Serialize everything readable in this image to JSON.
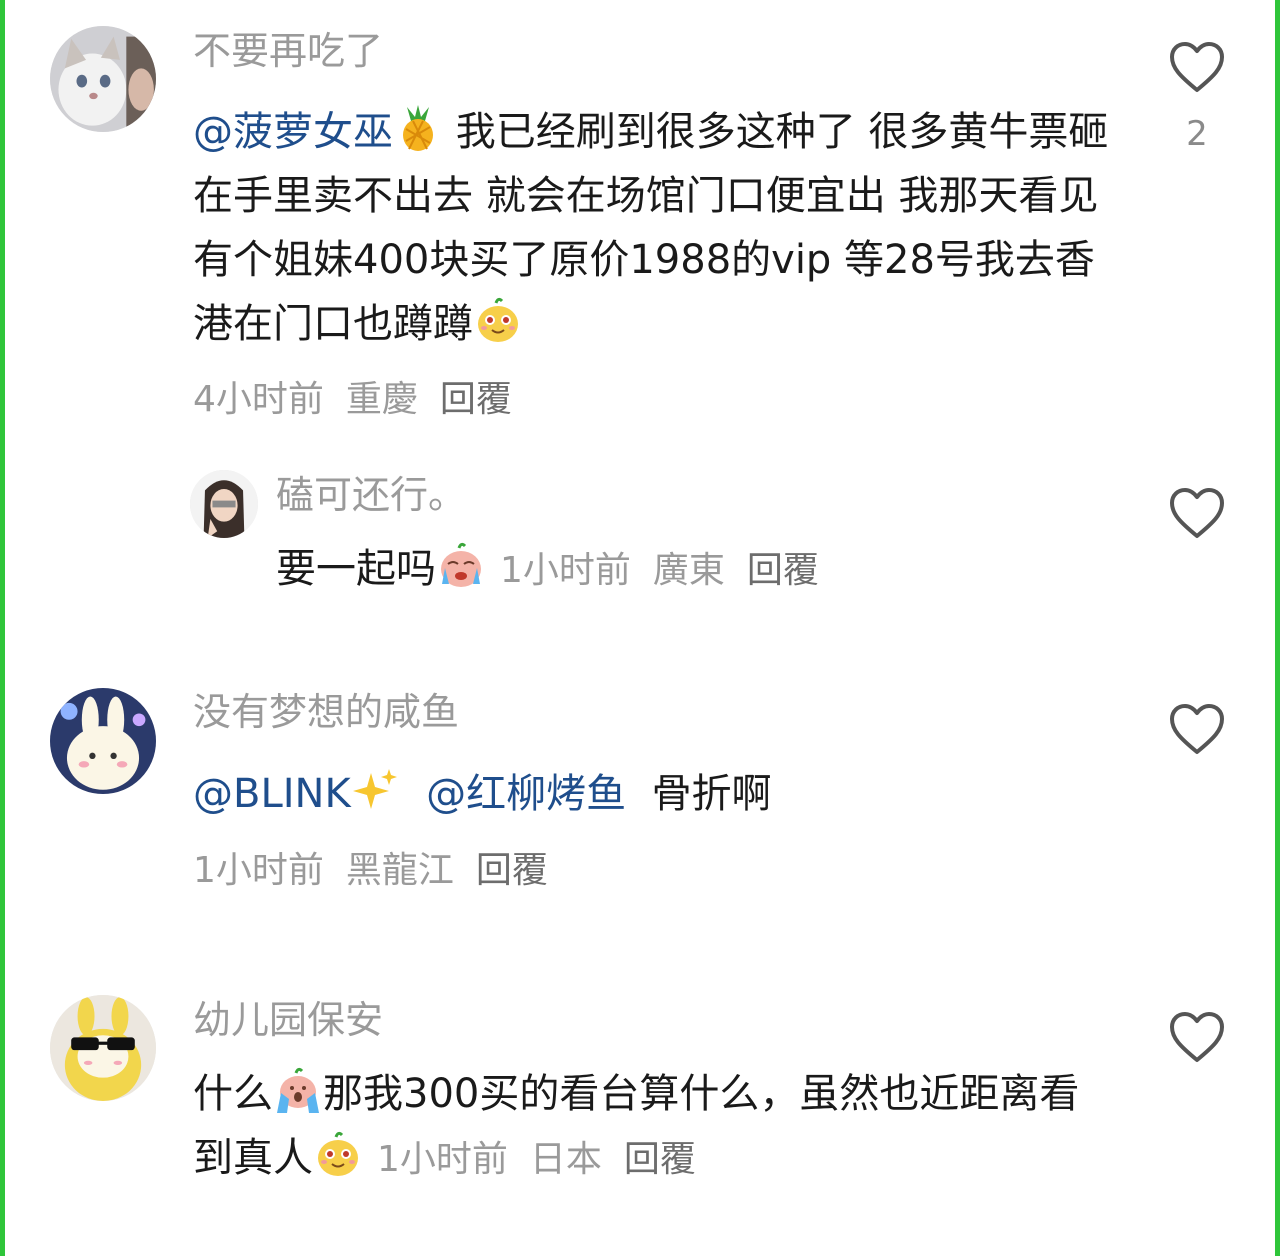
{
  "comments": [
    {
      "username": "不要再吃了",
      "mention": "@菠萝女巫",
      "text": " 我已经刷到很多这种了 很多黄牛票砸在手里卖不出去 就会在场馆门口便宜出 我那天看见有个姐妹400块买了原价1988的vip 等28号我去香港在门口也蹲蹲",
      "time": "4小时前",
      "location": "重慶",
      "reply": "回覆",
      "likes": "2"
    },
    {
      "username": "磕可还行。",
      "text": "要一起吗",
      "time": "1小时前",
      "location": "廣東",
      "reply": "回覆"
    },
    {
      "username": "没有梦想的咸鱼",
      "mention1": "@BLINK",
      "mention2": "@红柳烤鱼",
      "text": "骨折啊",
      "time": "1小时前",
      "location": "黑龍江",
      "reply": "回覆"
    },
    {
      "username": "幼儿园保安",
      "text_before": "什么",
      "text_after": "那我300买的看台算什么，虽然也近距离看到真人",
      "time": "1小时前",
      "location": "日本",
      "reply": "回覆"
    }
  ],
  "icons": {
    "like": "heart-outline-icon",
    "pineapple": "pineapple-emoji",
    "cheeky": "cheeky-face-emoji",
    "crying": "crying-face-emoji",
    "sparkles": "sparkles-emoji",
    "screaming": "screaming-face-emoji"
  },
  "colors": {
    "mention": "#1f4e8c",
    "secondary_text": "#9a9a9a",
    "edge": "#2fc53a"
  }
}
